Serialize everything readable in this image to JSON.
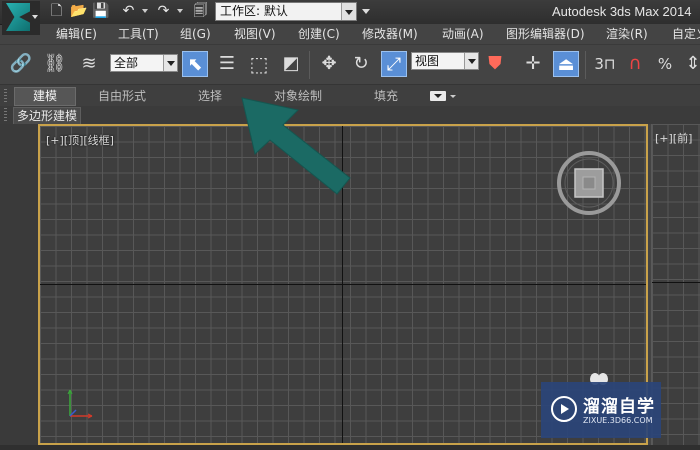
{
  "titlebar": {
    "workspace_value": "工作区: 默认",
    "app_title": "Autodesk 3ds Max  2014"
  },
  "menu": {
    "items": [
      "编辑(E)",
      "工具(T)",
      "组(G)",
      "视图(V)",
      "创建(C)",
      "修改器(M)",
      "动画(A)",
      "图形编辑器(D)",
      "渲染(R)",
      "自定义"
    ]
  },
  "toolbar": {
    "selection_filter": "全部",
    "reference_coord": "视图",
    "snap_angle_label": "3",
    "percent_label": "%"
  },
  "ribbon": {
    "tabs": [
      "建模",
      "自由形式",
      "选择",
      "对象绘制",
      "填充"
    ],
    "active_tab": "建模"
  },
  "subpanel": {
    "label": "多边形建模"
  },
  "viewport": {
    "label": "[+][顶][线框]",
    "border_color": "#c9a24a"
  },
  "right_viewport": {
    "label": "[+][前]"
  },
  "watermark": {
    "title": "溜溜自学",
    "url": "ZIXUE.3D66.COM"
  },
  "colors": {
    "arrow": "#1b6a64",
    "accent": "#5a8fd6"
  }
}
